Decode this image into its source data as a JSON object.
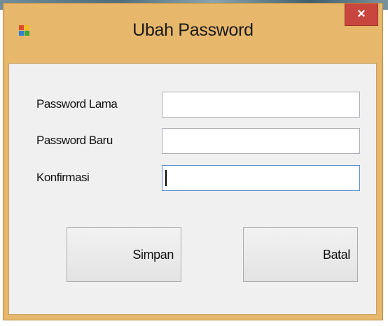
{
  "window": {
    "title": "Ubah Password",
    "close_glyph": "×",
    "app_icon": "form-app-icon"
  },
  "form": {
    "fields": [
      {
        "label": "Password Lama",
        "value": "",
        "placeholder": ""
      },
      {
        "label": "Password Baru",
        "value": "",
        "placeholder": ""
      },
      {
        "label": "Konfirmasi",
        "value": "",
        "placeholder": ""
      }
    ],
    "focused_field": "Konfirmasi"
  },
  "buttons": {
    "save_label": "Simpan",
    "cancel_label": "Batal"
  },
  "colors": {
    "frame": "#e7b86c",
    "close": "#c8463d",
    "client": "#f0f0f0",
    "focus_border": "#5a8fd0"
  }
}
